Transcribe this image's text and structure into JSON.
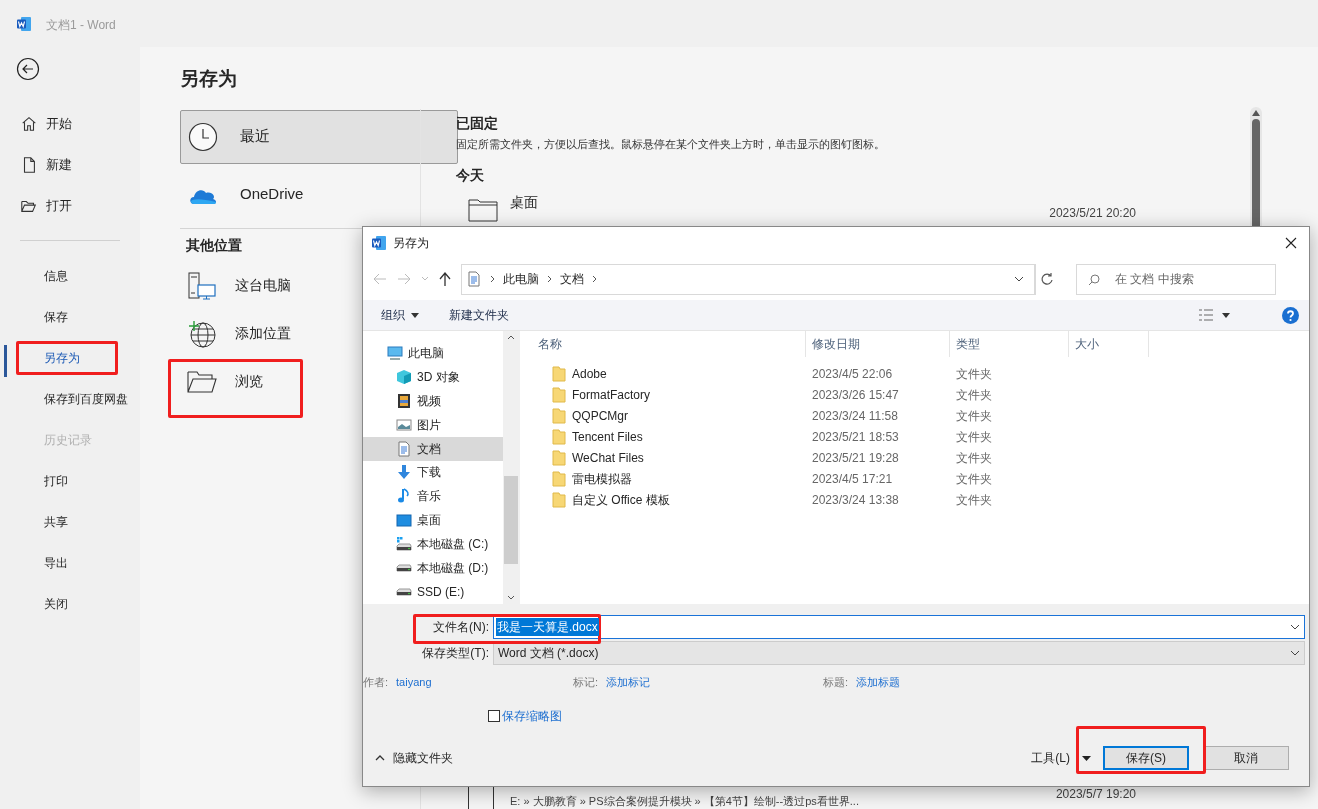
{
  "window": {
    "title": "文档1  -  Word"
  },
  "sidebar": {
    "primary_items": [
      {
        "label": "开始",
        "kind": "home"
      },
      {
        "label": "新建",
        "kind": "new"
      },
      {
        "label": "打开",
        "kind": "open"
      }
    ],
    "items": [
      {
        "label": "信息",
        "selected": false,
        "disabled": false,
        "highlighted": false
      },
      {
        "label": "保存",
        "selected": false,
        "disabled": false,
        "highlighted": false
      },
      {
        "label": "另存为",
        "selected": true,
        "disabled": false,
        "highlighted": true
      },
      {
        "label": "保存到百度网盘",
        "selected": false,
        "disabled": false,
        "highlighted": false
      },
      {
        "label": "历史记录",
        "selected": false,
        "disabled": true,
        "highlighted": false
      },
      {
        "label": "打印",
        "selected": false,
        "disabled": false,
        "highlighted": false
      },
      {
        "label": "共享",
        "selected": false,
        "disabled": false,
        "highlighted": false
      },
      {
        "label": "导出",
        "selected": false,
        "disabled": false,
        "highlighted": false
      },
      {
        "label": "关闭",
        "selected": false,
        "disabled": false,
        "highlighted": false
      }
    ]
  },
  "page_title": "另存为",
  "locations": [
    {
      "label": "最近",
      "kind": "clock",
      "selected": true
    },
    {
      "label": "OneDrive",
      "kind": "cloud",
      "selected": false
    }
  ],
  "other_heading": "其他位置",
  "other_locations": [
    {
      "label": "这台电脑",
      "kind": "pc",
      "highlighted": false
    },
    {
      "label": "添加位置",
      "kind": "globe",
      "highlighted": false
    },
    {
      "label": "浏览",
      "kind": "folder",
      "highlighted": true
    }
  ],
  "pinned": {
    "heading": "已固定",
    "hint": "固定所需文件夹，方便以后查找。鼠标悬停在某个文件夹上方时，单击显示的图钉图标。"
  },
  "today": {
    "heading": "今天",
    "rows": [
      {
        "name": "桌面",
        "date": "2023/5/21 20:20"
      }
    ]
  },
  "older_rows": [
    {
      "path": "E: » 大鹏教育 » PS综合案例提升模块 » 【第4节】绘制--透过ps看世界...",
      "date": "2023/5/7 19:20"
    }
  ],
  "dialog": {
    "title": "另存为",
    "breadcrumb": [
      "此电脑",
      "文档"
    ],
    "search": {
      "placeholder": "在 文档 中搜索"
    },
    "toolbar": {
      "organize": "组织",
      "new_folder": "新建文件夹"
    },
    "nav": [
      {
        "label": "此电脑",
        "kind": "pc",
        "selected": false
      },
      {
        "label": "3D 对象",
        "kind": "cube",
        "selected": false
      },
      {
        "label": "视频",
        "kind": "video",
        "selected": false
      },
      {
        "label": "图片",
        "kind": "picture",
        "selected": false
      },
      {
        "label": "文档",
        "kind": "doc",
        "selected": true
      },
      {
        "label": "下载",
        "kind": "download",
        "selected": false
      },
      {
        "label": "音乐",
        "kind": "music",
        "selected": false
      },
      {
        "label": "桌面",
        "kind": "desktop",
        "selected": false
      },
      {
        "label": "本地磁盘 (C:)",
        "kind": "sysdrive",
        "selected": false
      },
      {
        "label": "本地磁盘 (D:)",
        "kind": "drive",
        "selected": false
      },
      {
        "label": "SSD (E:)",
        "kind": "drive",
        "selected": false
      }
    ],
    "columns": [
      "名称",
      "修改日期",
      "类型",
      "大小"
    ],
    "rows": [
      {
        "name": "Adobe",
        "date": "2023/4/5 22:06",
        "type": "文件夹"
      },
      {
        "name": "FormatFactory",
        "date": "2023/3/26 15:47",
        "type": "文件夹"
      },
      {
        "name": "QQPCMgr",
        "date": "2023/3/24 11:58",
        "type": "文件夹"
      },
      {
        "name": "Tencent Files",
        "date": "2023/5/21 18:53",
        "type": "文件夹"
      },
      {
        "name": "WeChat Files",
        "date": "2023/5/21 19:28",
        "type": "文件夹"
      },
      {
        "name": "雷电模拟器",
        "date": "2023/4/5 17:21",
        "type": "文件夹"
      },
      {
        "name": "自定义 Office 模板",
        "date": "2023/3/24 13:38",
        "type": "文件夹"
      }
    ],
    "filename": {
      "label": "文件名(N):",
      "value": "我是一天算是.docx",
      "highlighted": true
    },
    "filetype": {
      "label": "保存类型(T):",
      "value": "Word 文档 (*.docx)"
    },
    "meta": [
      {
        "label": "作者:",
        "value": "taiyang"
      },
      {
        "label": "标记:",
        "value": "添加标记"
      },
      {
        "label": "标题:",
        "value": "添加标题"
      }
    ],
    "thumbnail": {
      "label": "保存缩略图",
      "checked": false
    },
    "hide_folders": "隐藏文件夹",
    "tools": "工具(L)",
    "save": {
      "label": "保存(S)",
      "highlighted": true
    },
    "cancel": "取消"
  }
}
